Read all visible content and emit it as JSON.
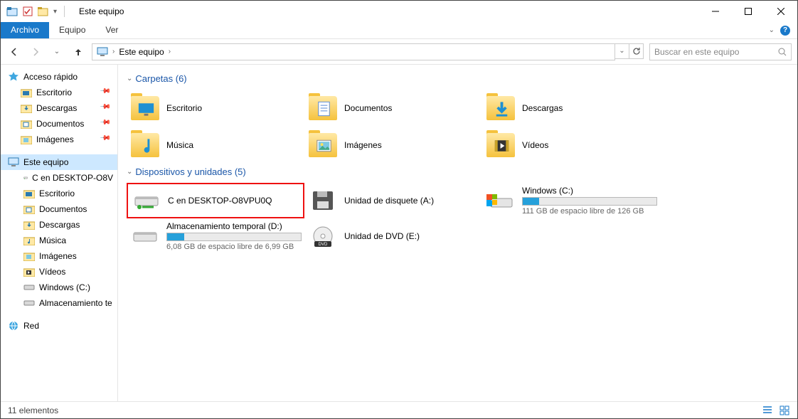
{
  "title": "Este equipo",
  "ribbon": {
    "tabs": [
      "Archivo",
      "Equipo",
      "Ver"
    ]
  },
  "nav": {
    "location": "Este equipo",
    "search_placeholder": "Buscar en este equipo"
  },
  "sidebar": {
    "quick": "Acceso rápido",
    "quick_items": [
      {
        "label": "Escritorio",
        "pin": true,
        "icon": "desktop"
      },
      {
        "label": "Descargas",
        "pin": true,
        "icon": "downloads"
      },
      {
        "label": "Documentos",
        "pin": true,
        "icon": "documents"
      },
      {
        "label": "Imágenes",
        "pin": true,
        "icon": "pictures"
      }
    ],
    "thispc": "Este equipo",
    "thispc_items": [
      {
        "label": "C en DESKTOP-O8V",
        "icon": "netdrive"
      },
      {
        "label": "Escritorio",
        "icon": "desktop"
      },
      {
        "label": "Documentos",
        "icon": "documents"
      },
      {
        "label": "Descargas",
        "icon": "downloads"
      },
      {
        "label": "Música",
        "icon": "music"
      },
      {
        "label": "Imágenes",
        "icon": "pictures"
      },
      {
        "label": "Vídeos",
        "icon": "videos"
      },
      {
        "label": "Windows (C:)",
        "icon": "drive"
      },
      {
        "label": "Almacenamiento te",
        "icon": "drive"
      }
    ],
    "network": "Red"
  },
  "groups": {
    "folders_header": "Carpetas (6)",
    "folders": [
      {
        "label": "Escritorio",
        "icon": "desktop"
      },
      {
        "label": "Documentos",
        "icon": "documents"
      },
      {
        "label": "Descargas",
        "icon": "downloads"
      },
      {
        "label": "Música",
        "icon": "music"
      },
      {
        "label": "Imágenes",
        "icon": "pictures"
      },
      {
        "label": "Vídeos",
        "icon": "videos"
      }
    ],
    "devices_header": "Dispositivos y unidades (5)",
    "devices": [
      {
        "label": "C en DESKTOP-O8VPU0Q",
        "icon": "netdrive",
        "highlight": true
      },
      {
        "label": "Unidad de disquete (A:)",
        "icon": "floppy"
      },
      {
        "label": "Windows (C:)",
        "icon": "windrive",
        "bar_pct": 12,
        "sub": "111 GB de espacio libre de 126 GB"
      },
      {
        "label": "Almacenamiento temporal (D:)",
        "icon": "drive",
        "bar_pct": 13,
        "sub": "6,08 GB de espacio libre de 6,99 GB"
      },
      {
        "label": "Unidad de DVD (E:)",
        "icon": "dvd"
      }
    ]
  },
  "status": "11 elementos"
}
